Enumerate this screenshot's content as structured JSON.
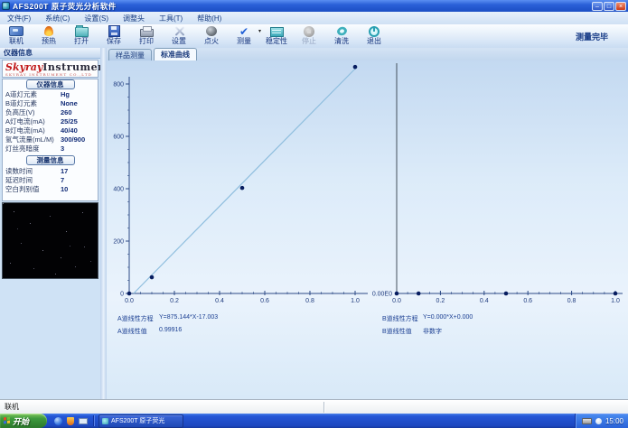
{
  "window": {
    "title": "AFS200T 原子荧光分析软件"
  },
  "icons": {
    "minimize": "–",
    "maximize": "□",
    "close": "×",
    "dropdown_arrow": "▾",
    "measure_check": "✔"
  },
  "menu": {
    "items": [
      {
        "label": "文件(F)"
      },
      {
        "label": "系统(C)"
      },
      {
        "label": "设置(S)"
      },
      {
        "label": "调整头"
      },
      {
        "label": "工具(T)"
      },
      {
        "label": "帮助(H)"
      }
    ]
  },
  "toolbar": {
    "buttons": [
      {
        "label": "联机",
        "enabled": true
      },
      {
        "label": "预热",
        "enabled": true
      },
      {
        "label": "打开",
        "enabled": true
      },
      {
        "label": "保存",
        "enabled": true
      },
      {
        "label": "打印",
        "enabled": true
      },
      {
        "label": "设置",
        "enabled": true
      },
      {
        "label": "点火",
        "enabled": true
      },
      {
        "label": "测量",
        "enabled": true
      },
      {
        "label": "稳定性",
        "enabled": true
      },
      {
        "label": "停止",
        "enabled": false
      },
      {
        "label": "清洗",
        "enabled": true
      },
      {
        "label": "退出",
        "enabled": true
      }
    ],
    "status": "测量完毕"
  },
  "sidebar": {
    "panel_title": "仪器信息",
    "logo": {
      "brand_italic": "Skyray",
      "brand_rest": "Instrument",
      "subtitle": "SKYRAY INSTRUMENT CO.,LTD"
    },
    "instrument": {
      "header": "仪器信息",
      "rows": [
        {
          "label": "A道灯元素",
          "value": "Hg"
        },
        {
          "label": "B道灯元素",
          "value": "None"
        },
        {
          "label": "负高压(V)",
          "value": "260"
        },
        {
          "label": "A灯电流(mA)",
          "value": "25/25"
        },
        {
          "label": "B灯电流(mA)",
          "value": "40/40"
        },
        {
          "label": "氩气流量(mL/M)",
          "value": "300/900"
        },
        {
          "label": "灯丝亮暗度",
          "value": "3"
        }
      ]
    },
    "measurement": {
      "header": "测量信息",
      "rows": [
        {
          "label": "读数时间",
          "value": "17"
        },
        {
          "label": "延迟时间",
          "value": "7"
        },
        {
          "label": "空白判别值",
          "value": "10"
        }
      ]
    }
  },
  "tabs": {
    "items": [
      {
        "label": "样品测量"
      },
      {
        "label": "标准曲线"
      }
    ],
    "active_index": 1
  },
  "chart_data": [
    {
      "type": "scatter",
      "channel": "A",
      "x": [
        0,
        0.1,
        0.5,
        1.0
      ],
      "y": [
        0,
        62,
        403,
        865
      ],
      "fit_line": {
        "slope": 875.144,
        "intercept": -17.003
      },
      "xlim": [
        0,
        1.05
      ],
      "ylim": [
        0,
        900
      ],
      "x_ticks": [
        0,
        0.2,
        0.4,
        0.6,
        0.8,
        1.0
      ],
      "y_ticks": [
        0,
        200,
        400,
        600,
        800
      ],
      "x_minor_step": 0.05,
      "y_minor_step": 50,
      "equation_label": "A道线性方程",
      "equation": "Y=875.144*X-17.003",
      "r_label": "A道线性值",
      "r_value": "0.99916"
    },
    {
      "type": "scatter",
      "channel": "B",
      "x": [
        0,
        0.1,
        0.5,
        1.0
      ],
      "y": [
        0,
        0,
        0,
        0
      ],
      "xlim": [
        0,
        1.05
      ],
      "ylim": [
        0,
        1
      ],
      "x_ticks": [
        0,
        0.2,
        0.4,
        0.6,
        0.8,
        1.0
      ],
      "x_minor_step": 0.05,
      "y_axis_value_label": "0.00E0",
      "equation_label": "B道线性方程",
      "equation": "Y=0.000*X+0.000",
      "r_label": "B道线性值",
      "r_value": "非数字"
    }
  ],
  "colors": {
    "axis": "#2c4a86",
    "axis_dark": "#44505c",
    "fit_line": "#8fbede",
    "point": "#071d60",
    "tick_text": "#1f3b7e"
  },
  "statusbar": {
    "text": "联机"
  },
  "taskbar": {
    "start_label": "开始",
    "task_label": "AFS200T 原子荧光",
    "clock": "15:00"
  }
}
